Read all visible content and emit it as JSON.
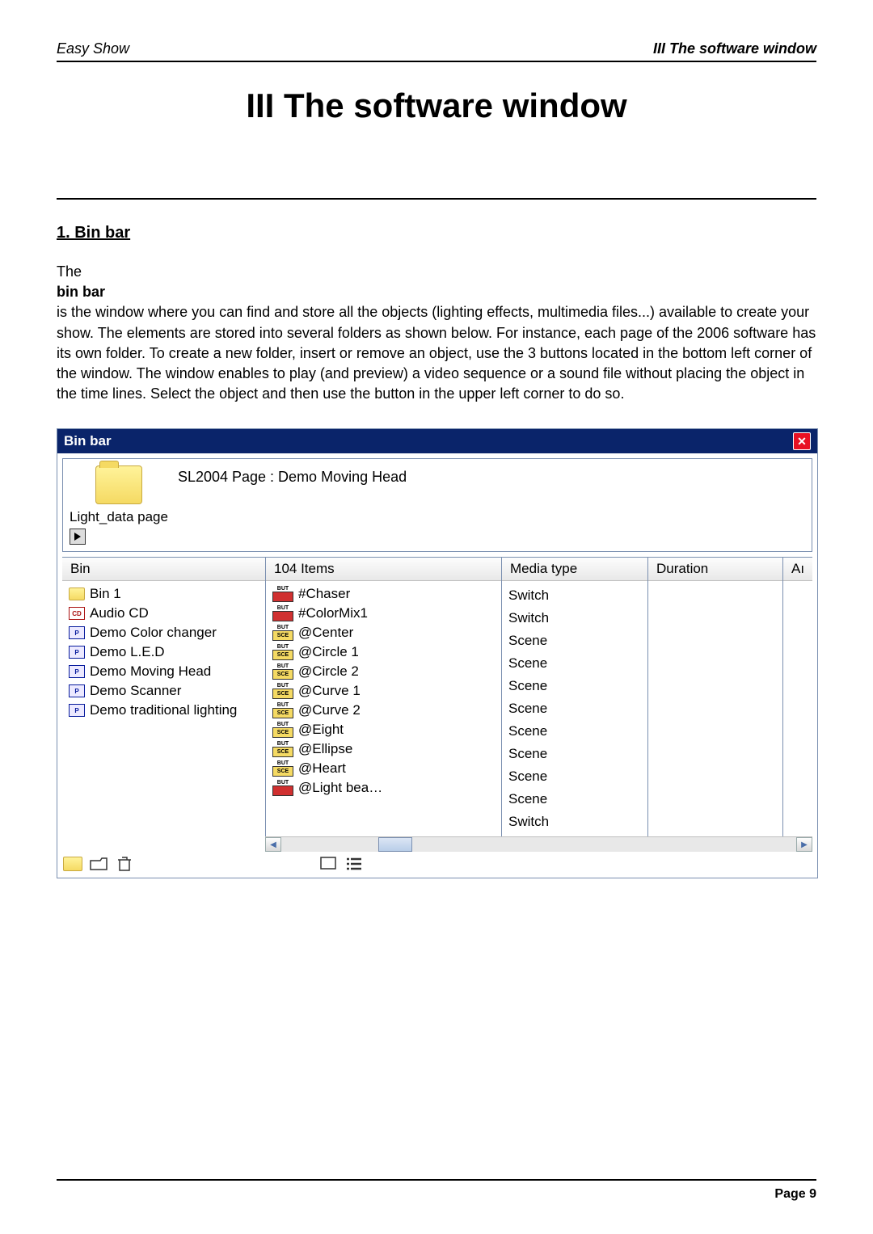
{
  "header": {
    "left": "Easy Show",
    "right": "III The software window"
  },
  "title": "III The software window",
  "section_heading": "1. Bin bar",
  "para_the": "The",
  "para_bold": "bin bar",
  "para_rest": " is the window where you can find and store all the objects (lighting effects, multimedia files...) available to create your show. The elements are stored into several folders as shown below. For instance, each page of the 2006 software has its own folder. To create a new folder, insert or remove an object, use the 3 buttons located in the bottom left corner of the window. The window enables to play (and preview) a video sequence or a sound file without placing the object in the time lines. Select the object and then use the button in the upper left corner to do so.",
  "win": {
    "title": "Bin bar",
    "folder_label": "Light_data page",
    "page_label": "SL2004 Page : Demo Moving Head",
    "headers": {
      "bin": "Bin",
      "items": "104 Items",
      "media": "Media type",
      "duration": "Duration",
      "last": "Aı"
    },
    "bin_items": [
      {
        "icon": "folder",
        "label": "Bin 1"
      },
      {
        "icon": "cd",
        "label": "Audio CD"
      },
      {
        "icon": "p",
        "label": "Demo Color changer"
      },
      {
        "icon": "p",
        "label": "Demo L.E.D"
      },
      {
        "icon": "p",
        "label": "Demo Moving Head"
      },
      {
        "icon": "p",
        "label": "Demo Scanner"
      },
      {
        "icon": "p",
        "label": "Demo traditional lighting"
      }
    ],
    "items": [
      {
        "icon": "red",
        "label": "#Chaser",
        "media": "Switch"
      },
      {
        "icon": "red",
        "label": "#ColorMix1",
        "media": "Switch"
      },
      {
        "icon": "yel",
        "label": "@Center",
        "media": "Scene"
      },
      {
        "icon": "yel",
        "label": "@Circle 1",
        "media": "Scene"
      },
      {
        "icon": "yel",
        "label": "@Circle 2",
        "media": "Scene"
      },
      {
        "icon": "yel",
        "label": "@Curve 1",
        "media": "Scene"
      },
      {
        "icon": "yel",
        "label": "@Curve 2",
        "media": "Scene"
      },
      {
        "icon": "yel",
        "label": "@Eight",
        "media": "Scene"
      },
      {
        "icon": "yel",
        "label": "@Ellipse",
        "media": "Scene"
      },
      {
        "icon": "yel",
        "label": "@Heart",
        "media": "Scene"
      },
      {
        "icon": "red",
        "label": "@Light bea…",
        "media": "Switch"
      }
    ]
  },
  "footer": "Page 9"
}
